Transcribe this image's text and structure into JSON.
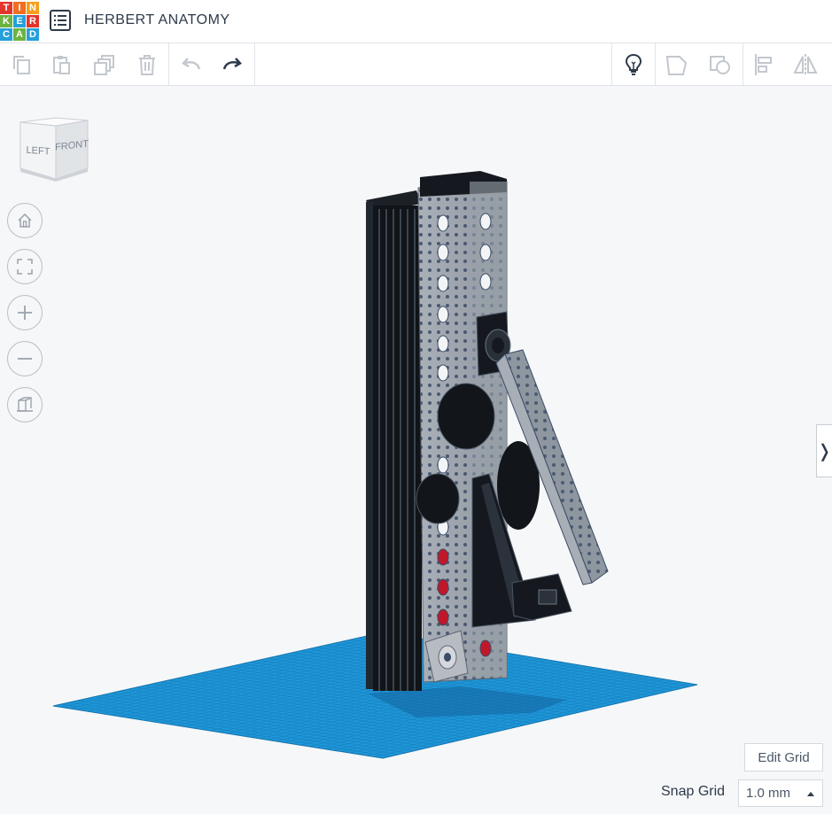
{
  "header": {
    "logo_letters": [
      "T",
      "I",
      "N",
      "K",
      "E",
      "R",
      "C",
      "A",
      "D"
    ],
    "logo_colors": [
      "#e4352b",
      "#f16e22",
      "#f6a01a",
      "#6db33f",
      "#25a0da",
      "#e4352b",
      "#25a0da",
      "#6db33f",
      "#25a0da"
    ],
    "title": "HERBERT ANATOMY"
  },
  "toolbar": {
    "items": [
      {
        "name": "copy-icon",
        "enabled": false
      },
      {
        "name": "paste-icon",
        "enabled": false
      },
      {
        "name": "duplicate-icon",
        "enabled": false
      },
      {
        "name": "delete-icon",
        "enabled": false
      },
      {
        "name": "undo-icon",
        "enabled": false
      },
      {
        "name": "redo-icon",
        "enabled": true
      },
      {
        "name": "lightbulb-icon",
        "enabled": true
      },
      {
        "name": "group-icon",
        "enabled": false
      },
      {
        "name": "ungroup-icon",
        "enabled": false
      },
      {
        "name": "align-icon",
        "enabled": false
      },
      {
        "name": "mirror-icon",
        "enabled": false
      }
    ]
  },
  "view_cube": {
    "left_label": "LEFT",
    "front_label": "FRONT"
  },
  "nav_controls": [
    "home-view-icon",
    "fit-all-icon",
    "zoom-in-icon",
    "zoom-out-icon",
    "perspective-icon"
  ],
  "workplane": {
    "grid_color": "#1e96d8",
    "grid_line_color": "#0f6fa8"
  },
  "right_panel_toggle": "❭",
  "footer": {
    "edit_grid_label": "Edit Grid",
    "snap_grid_label": "Snap Grid",
    "snap_grid_value": "1.0 mm"
  }
}
